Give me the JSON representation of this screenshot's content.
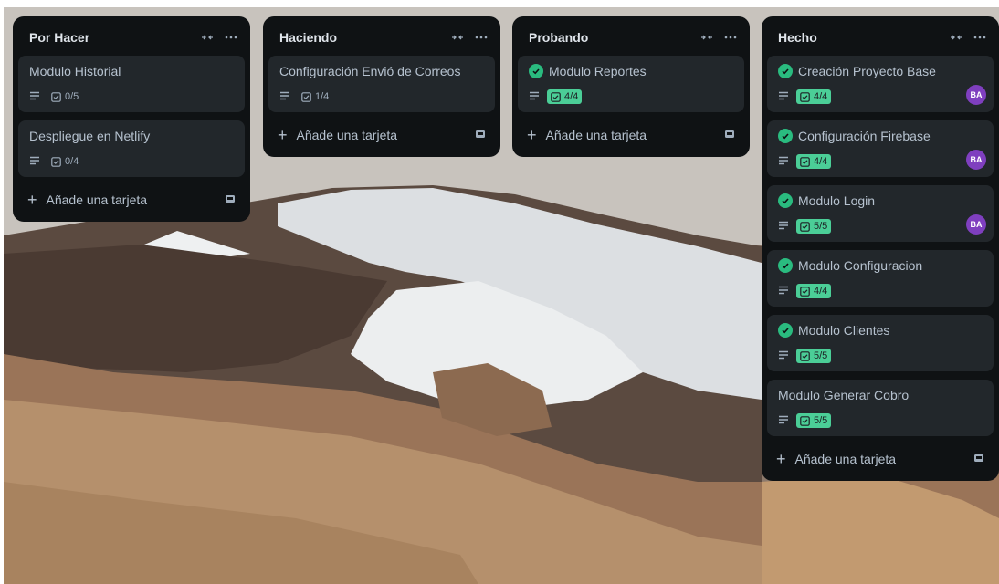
{
  "lists": [
    {
      "title": "Por Hacer",
      "add_label": "Añade una tarjeta",
      "cards": [
        {
          "title": "Modulo Historial",
          "checklist": "0/5",
          "complete": false,
          "avatar": ""
        },
        {
          "title": "Despliegue en Netlify",
          "checklist": "0/4",
          "complete": false,
          "avatar": ""
        }
      ]
    },
    {
      "title": "Haciendo",
      "add_label": "Añade una tarjeta",
      "cards": [
        {
          "title": "Configuración Envió de Correos",
          "checklist": "1/4",
          "complete": false,
          "avatar": ""
        }
      ]
    },
    {
      "title": "Probando",
      "add_label": "Añade una tarjeta",
      "cards": [
        {
          "title": "Modulo Reportes",
          "checklist": "4/4",
          "complete": true,
          "avatar": ""
        }
      ]
    },
    {
      "title": "Hecho",
      "add_label": "Añade una tarjeta",
      "cards": [
        {
          "title": "Creación Proyecto Base",
          "checklist": "4/4",
          "complete": true,
          "avatar": "BA"
        },
        {
          "title": "Configuración Firebase",
          "checklist": "4/4",
          "complete": true,
          "avatar": "BA"
        },
        {
          "title": "Modulo Login",
          "checklist": "5/5",
          "complete": true,
          "avatar": "BA"
        },
        {
          "title": "Modulo Configuracion",
          "checklist": "4/4",
          "complete": true,
          "avatar": ""
        },
        {
          "title": "Modulo Clientes",
          "checklist": "5/5",
          "complete": true,
          "avatar": ""
        },
        {
          "title": "Modulo Generar Cobro",
          "checklist": "5/5",
          "complete": false,
          "avatar": ""
        }
      ]
    }
  ],
  "icons": {
    "collapse": "collapse-icon",
    "more": "more-icon",
    "description": "description-icon",
    "checklist": "checklist-icon",
    "template": "template-icon",
    "check": "check-circle-icon"
  },
  "colors": {
    "list_bg": "#0f1214",
    "card_bg": "#22272b",
    "complete_green": "#2abb7f",
    "checklist_done_bg": "#4bce97",
    "avatar_purple": "#7f3fbf"
  }
}
